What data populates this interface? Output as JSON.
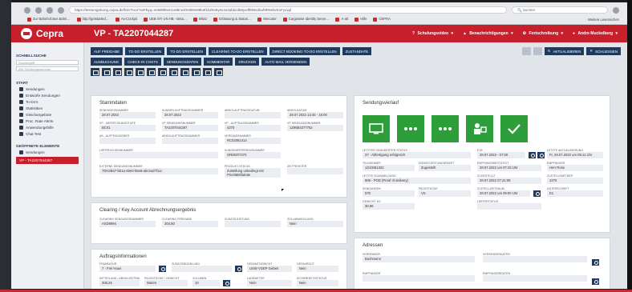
{
  "browser": {
    "url": "https://testumgebung.cepra.de/fa/cTrxx/?xxFbyq=xn9d0l8xm1x8bnx40n5l0m88b4f1b29x8y0x3x2pbbx3b8yxdf6h8x3bxf9R9sfxrExFyvxpf",
    "search_placeholder": "Suchen",
    "bookmarks": [
      "Zur Bahnhof.Bus Bahn…",
      "http://getstarted…",
      "As-Cockpit",
      "UEB STI UN HB - Beta…",
      "Blitzz",
      "Erfassung & Status…",
      "Mercator",
      "Cargowise Identity Serve…",
      "A-alt",
      "Hilfe",
      "CEPRA"
    ],
    "bookmarks_right": "Weitere Lesezeichen"
  },
  "app": {
    "logo": "Cepra",
    "title": "VP - TA2207044287",
    "nav": [
      "Schulungsvideo",
      "Benachrichtigungen",
      "Fortschreibung",
      "Andre Muckelberg"
    ]
  },
  "sidebar": {
    "section1": "SCHNELLSUCHE",
    "inputs": [
      "Suchbegriff",
      "Alle Sendungsnummer"
    ],
    "section2": "START",
    "items": [
      "Sendungen",
      "Entwürfe Sendungen",
      "To-Do's",
      "Statistiken",
      "Gleichangebote",
      "Proc. Rate Alerts",
      "Anwendungshilfe",
      "Chat Test"
    ],
    "section3": "GEÖFFNETE ELEMENTE",
    "open_items": [
      "Sendungen",
      "VP - TA2207044287"
    ]
  },
  "toolbar": {
    "row1": [
      "AUF FREIGABE",
      "TO-DO ERSTELLEN",
      "TO-DO ERSTELLEN",
      "CLEARING TO-DO ERSTELLEN",
      "DIRECT BOOKING TO-DO ERSTELLEN",
      "ZUSTANDATE"
    ],
    "row2": [
      "AUSBUCHUNG",
      "CHECK-IN COSTS",
      "SENDUNGSDATEN",
      "KOMMENTAR",
      "DRUCKEN",
      "AUTO-MAIL VERSENDEN"
    ],
    "right": [
      "AKTUALISIEREN",
      "SCHLIESSEN"
    ]
  },
  "stammdaten": {
    "heading": "Stammdaten",
    "fields": [
      {
        "label": "Sendungsnummer",
        "value": "28.07.2022"
      },
      {
        "label": "Kunden-Auftragsnummer",
        "value": "28.07.2022"
      },
      {
        "label": "Abholauftragsdatum",
        "value": ""
      },
      {
        "label": "Abholdatum",
        "value": "28.07.2022 13:45 - 16:00"
      },
      {
        "label": "VP - Abfertigungstufe",
        "value": "BC01"
      },
      {
        "label": "VP Sendungsnummer",
        "value": "TA2207044287"
      },
      {
        "label": "VP - Auftragsnummer",
        "value": "4270"
      },
      {
        "label": "VP Sendungsnummer",
        "value": "1Z95B4377752"
      },
      {
        "label": "AS - Auftraggeber",
        "value": ""
      },
      {
        "label": "Abholauftragsnummer",
        "value": ""
      },
      {
        "label": "Versandnummer",
        "value": "RC02081414"
      },
      {
        "label": "Lieferscheinnummer",
        "value": ""
      },
      {
        "label": "Kundenreferenznummer",
        "value": "ORDER7270"
      },
      {
        "label": "Externe Sendungsnummer",
        "value": "7DH2B47-bb1a-46e0-b5e8-abc2ad7f11c"
      },
      {
        "label": "Produkt-Status",
        "value": "Zustellung unbedingt mit Prioritätsflatrate"
      },
      {
        "label": "Zeitfenster",
        "value": ""
      }
    ]
  },
  "sendungsverlauf": {
    "heading": "Sendungsverlauf",
    "steps": [
      "monitor-icon",
      "dots-icon",
      "dots-icon",
      "handover-icon",
      "check-icon"
    ],
    "fields": [
      {
        "label": "Letzter geänderter Status",
        "value": "37 - Abfertigung erfolgreich"
      },
      {
        "label": "ETA",
        "value": "29.07.2022 - 07:00"
      },
      {
        "label": "Letzte Aktualisierung",
        "value": "Fr, 29.07.2022 um 09:11 Uhr"
      },
      {
        "label": "Teilnehmer",
        "value": "1Z10081322"
      },
      {
        "label": "Dienstleistungspaket",
        "value": "Zugestellt"
      },
      {
        "label": "Empfangsbestätigt",
        "value": "29.07.2022 um 07:43 Uhr"
      },
      {
        "label": "Empfänger",
        "value": "Herr Rose"
      },
      {
        "label": "Letzte Scanmeldung",
        "value": "806 - POD (Proof of delivery)"
      },
      {
        "label": "Zugestellt",
        "value": "29.07.2022 07:41:08"
      },
      {
        "label": "Zustellpartner",
        "value": "4270"
      },
      {
        "label": "Sendungen",
        "value": "570"
      },
      {
        "label": "Packstücke",
        "value": "VS"
      },
      {
        "label": "Zustellzeitraum",
        "value": "29.07.2022 um 09:00 Uhr"
      },
      {
        "label": "Unterschrift",
        "value": "E1"
      },
      {
        "label": "Gewicht kg",
        "value": "30,86"
      },
      {
        "label": "Lieferstatus",
        "value": ""
      }
    ]
  },
  "clearing": {
    "heading": "Clearing / Key Account Abrechnungsergebnis",
    "fields": [
      {
        "label": "Clearing Sendungsnummer",
        "value": "ASD8994"
      },
      {
        "label": "Clearing Freigabe",
        "value": "304,80"
      },
      {
        "label": "Zusatzleistung",
        "value": ""
      },
      {
        "label": "Zollabwicklung",
        "value": "Nein"
      }
    ]
  },
  "auftrag": {
    "heading": "Auftragsinformationen",
    "fields": [
      {
        "label": "Frankatur",
        "value": "7 - Frei Haus"
      },
      {
        "label": "Zusatzbezahlung",
        "value": ""
      },
      {
        "label": "Gesamtgewicht",
        "value": "USW VGEP Gebiet"
      },
      {
        "label": "Gefahrgut",
        "value": "Nein"
      },
      {
        "label": "Mitteilung / Abholzeitraum",
        "value": "306,25"
      },
      {
        "label": "Packstücke / Gewicht",
        "value": "Waren"
      },
      {
        "label": "Volumen",
        "value": "10"
      },
      {
        "label": "Lademeter",
        "value": "Nein"
      },
      {
        "label": "Sicherheitsstatus",
        "value": "Nein"
      }
    ]
  },
  "adressen": {
    "heading": "Adressen",
    "fields": [
      {
        "label": "Versender",
        "value": "Buchmann"
      },
      {
        "label": "Versenderdaten",
        "value": ""
      },
      {
        "label": "Empfänger",
        "value": ""
      },
      {
        "label": "Empfängerdaten",
        "value": ""
      }
    ]
  }
}
